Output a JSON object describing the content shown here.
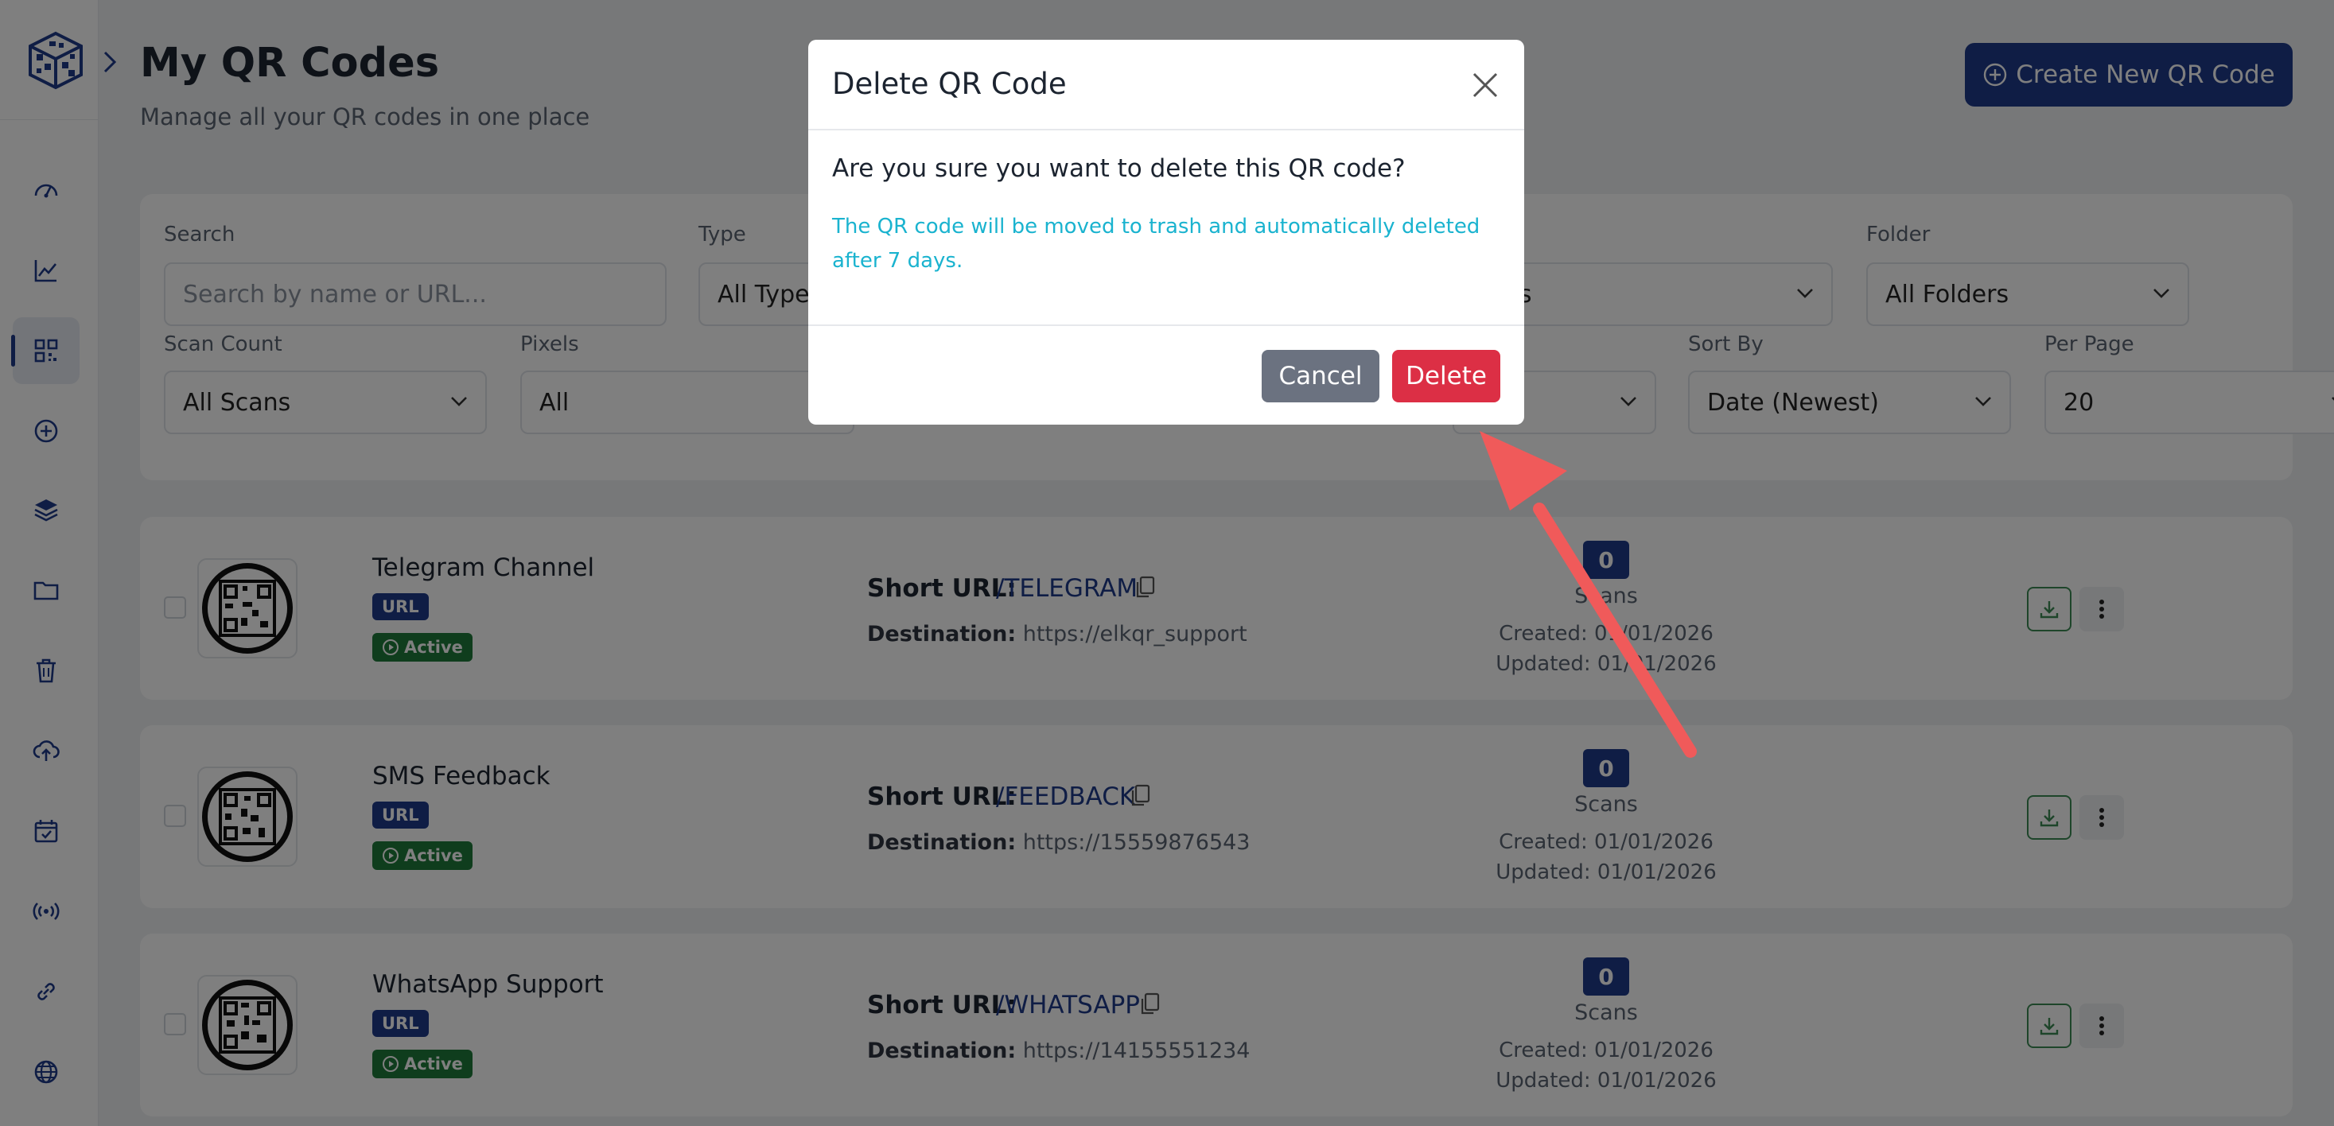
{
  "app": {
    "title": "My QR Codes",
    "subtitle": "Manage all your QR codes in one place",
    "create_label": "Create New QR Code"
  },
  "colors": {
    "primary": "#1e3a8a",
    "danger": "#dc2f45",
    "success": "#1f7a3a",
    "info": "#1ab3cf",
    "annotation_arrow": "#f05a5a"
  },
  "sidebar": {
    "icons": [
      "dashboard-icon",
      "analytics-icon",
      "qr-code-icon",
      "add-circle-icon",
      "layers-icon",
      "folder-icon",
      "trash-icon",
      "cloud-upload-icon",
      "calendar-check-icon",
      "broadcast-icon",
      "link-icon",
      "globe-icon"
    ],
    "active": "qr-code-icon"
  },
  "filters": {
    "search": {
      "label": "Search",
      "placeholder": "Search by name or URL..."
    },
    "type": {
      "label": "Type",
      "value": "All Types"
    },
    "status": {
      "value": "odes"
    },
    "folder": {
      "label": "Folder",
      "value": "All Folders"
    },
    "scan_count": {
      "label": "Scan Count",
      "value": "All Scans"
    },
    "pixels": {
      "label": "Pixels",
      "value": "All"
    },
    "sort_by": {
      "label": "Sort By",
      "value": "Date (Newest)"
    },
    "per_page": {
      "label": "Per Page",
      "value": "20"
    }
  },
  "rows": [
    {
      "name": "Telegram Channel",
      "type": "URL",
      "status": "Active",
      "short_label": "Short URL:",
      "short_url": "/TELEGRAM",
      "dest_label": "Destination:",
      "destination": "https://elkqr_support",
      "scans": "0",
      "scans_label": "Scans",
      "created": "Created: 01/01/2026",
      "updated": "Updated: 01/01/2026"
    },
    {
      "name": "SMS Feedback",
      "type": "URL",
      "status": "Active",
      "short_label": "Short URL:",
      "short_url": "/FEEDBACK",
      "dest_label": "Destination:",
      "destination": "https://15559876543",
      "scans": "0",
      "scans_label": "Scans",
      "created": "Created: 01/01/2026",
      "updated": "Updated: 01/01/2026"
    },
    {
      "name": "WhatsApp Support",
      "type": "URL",
      "status": "Active",
      "short_label": "Short URL:",
      "short_url": "/WHATSAPP",
      "dest_label": "Destination:",
      "destination": "https://14155551234",
      "scans": "0",
      "scans_label": "Scans",
      "created": "Created: 01/01/2026",
      "updated": "Updated: 01/01/2026"
    }
  ],
  "modal": {
    "title": "Delete QR Code",
    "question": "Are you sure you want to delete this QR code?",
    "note": "The QR code will be moved to trash and automatically deleted after 7 days.",
    "cancel_label": "Cancel",
    "delete_label": "Delete"
  }
}
